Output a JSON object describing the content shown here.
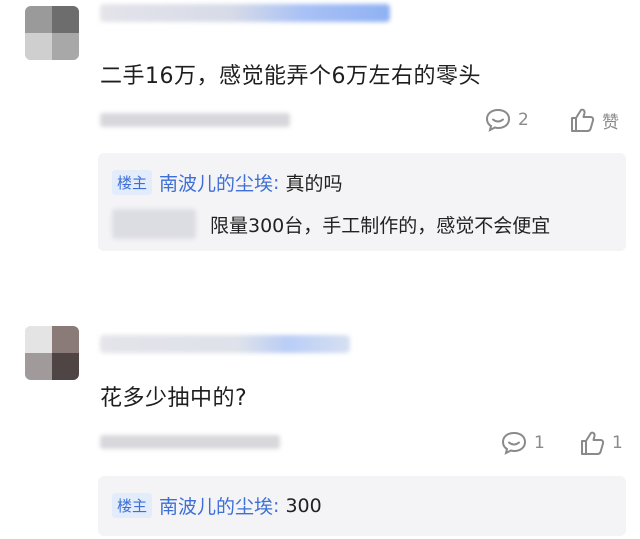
{
  "comments": [
    {
      "content": "二手16万，感觉能弄个6万左右的零头",
      "reply_count": "2",
      "like_label": "赞",
      "replies": [
        {
          "badge": "楼主",
          "author": "南波儿的尘埃",
          "sep": ":",
          "text": "真的吗"
        },
        {
          "text": "限量300台，手工制作的，感觉不会便宜"
        }
      ]
    },
    {
      "content": "花多少抽中的?",
      "reply_count": "1",
      "like_count": "1",
      "replies": [
        {
          "badge": "楼主",
          "author": "南波儿的尘埃",
          "sep": ":",
          "text": "300"
        }
      ]
    }
  ],
  "icons": {
    "reply": "comment-bubble-icon",
    "like": "thumbs-up-icon"
  },
  "colors": {
    "accent": "#3d6fd6",
    "badge_bg": "#e3ecfb",
    "reply_bg": "#f4f4f6",
    "muted": "#8a8a8a"
  }
}
